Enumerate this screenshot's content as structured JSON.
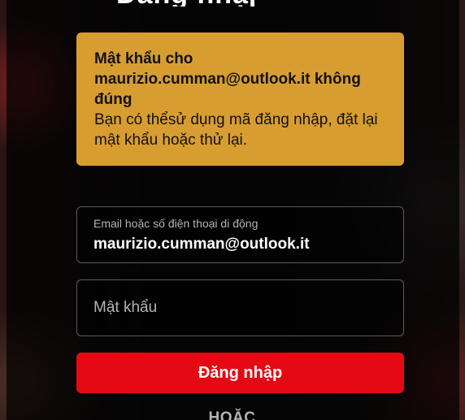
{
  "header": {
    "title_fragment": "Đăng nhập"
  },
  "alert": {
    "title": "Mật khẩu cho maurizio.cumman@outlook.it không đúng",
    "body": "Bạn có thểsử dụng mã đăng nhập, đặt lại mật khẩu hoặc thử lại."
  },
  "form": {
    "email": {
      "label": "Email hoặc số điện thoại di động",
      "value": "maurizio.cumman@outlook.it"
    },
    "password": {
      "placeholder": "Mật khẩu",
      "value": ""
    },
    "sign_in_label": "Đăng nhập",
    "or_label": "HOẶC"
  },
  "colors": {
    "alert_bg": "#d89d31",
    "primary_button": "#e50914",
    "panel_bg": "rgba(0,0,0,0.72)"
  }
}
